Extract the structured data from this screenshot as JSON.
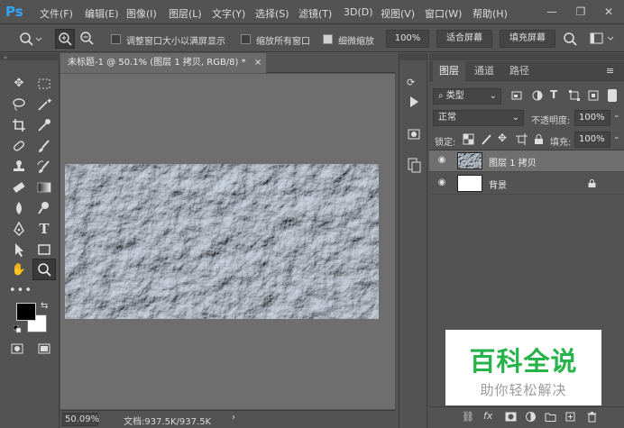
{
  "app": {
    "logo": "Ps"
  },
  "menu": [
    "文件(F)",
    "编辑(E)",
    "图像(I)",
    "图层(L)",
    "文字(Y)",
    "选择(S)",
    "滤镜(T)",
    "3D(D)",
    "视图(V)",
    "窗口(W)",
    "帮助(H)"
  ],
  "window_controls": {
    "minimize": "—",
    "restore": "❐",
    "close": "✕"
  },
  "options": {
    "resize_windows": "调整窗口大小以满屏显示",
    "zoom_all": "缩放所有窗口",
    "scrubby_zoom": "细微缩放",
    "zoom_value": "100%",
    "fit_screen": "适合屏幕",
    "fill_screen": "填充屏幕"
  },
  "document": {
    "tab_title": "未标题-1 @ 50.1% (图层 1 拷贝, RGB/8) *",
    "tab_close": "×",
    "zoom_status": "50.09%",
    "doc_size": "文档:937.5K/937.5K"
  },
  "layers_panel": {
    "tabs": [
      "图层",
      "通道",
      "路径"
    ],
    "filter_kind": "类型",
    "blend_mode": "正常",
    "opacity_label": "不透明度:",
    "opacity_value": "100%",
    "lock_label": "锁定:",
    "fill_label": "填充:",
    "fill_value": "100%",
    "layers": [
      {
        "name": "图层 1 拷贝",
        "selected": true,
        "visible": true
      },
      {
        "name": "背景",
        "selected": false,
        "visible": true,
        "locked": true
      }
    ]
  },
  "watermark": {
    "title": "百科全说",
    "subtitle": "助你轻松解决"
  },
  "colors": {
    "accent": "#31a8ff",
    "panel": "#535353",
    "canvas_bg": "#6e6e6e",
    "watermark_green": "#26b34a"
  }
}
